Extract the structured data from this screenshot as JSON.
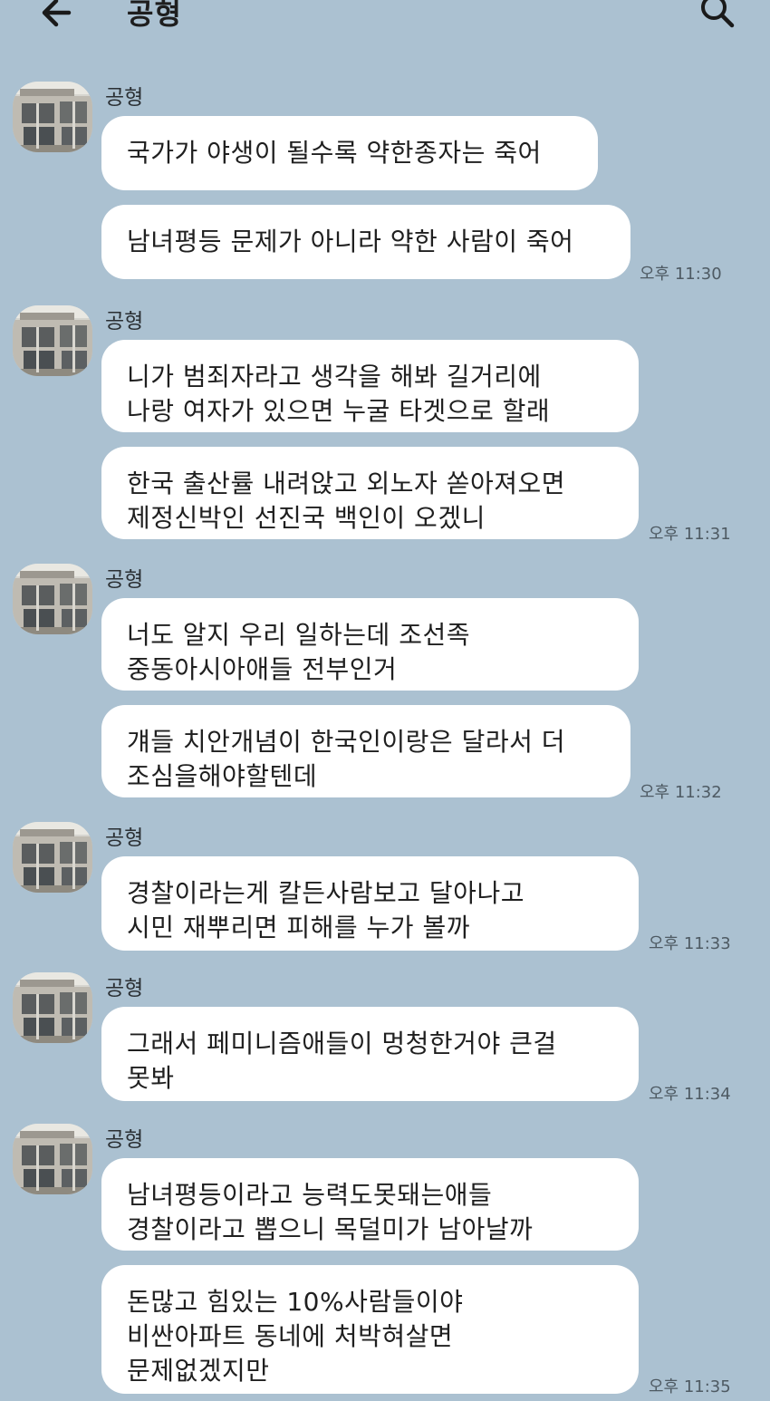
{
  "header": {
    "title": "공형"
  },
  "messages": [
    {
      "sender": "공형",
      "bubbles": [
        "국가가 야생이 될수록 약한종자는 죽어",
        "남녀평등 문제가 아니라 약한 사람이 죽어"
      ],
      "time": "오후 11:30"
    },
    {
      "sender": "공형",
      "bubbles": [
        "니가 범죄자라고 생각을 해봐 길거리에\n나랑 여자가 있으면 누굴 타겟으로 할래",
        "한국 출산률 내려앉고 외노자 쏟아져오면\n제정신박인 선진국 백인이 오겠니"
      ],
      "time": "오후 11:31"
    },
    {
      "sender": "공형",
      "bubbles": [
        "너도 알지 우리 일하는데 조선족\n중동아시아애들 전부인거",
        "걔들 치안개념이 한국인이랑은 달라서 더\n조심을해야할텐데"
      ],
      "time": "오후 11:32"
    },
    {
      "sender": "공형",
      "bubbles": [
        "경찰이라는게 칼든사람보고 달아나고\n시민 재뿌리면 피해를 누가 볼까"
      ],
      "time": "오후 11:33"
    },
    {
      "sender": "공형",
      "bubbles": [
        "그래서 페미니즘애들이 멍청한거야 큰걸\n못봐"
      ],
      "time": "오후 11:34"
    },
    {
      "sender": "공형",
      "bubbles": [
        "남녀평등이라고 능력도못돼는애들\n경찰이라고 뽑으니 목덜미가 남아날까",
        "돈많고 힘있는 10%사람들이야\n비싼아파트 동네에 처박혀살면\n문제없겠지만"
      ],
      "time": "오후 11:35"
    }
  ]
}
